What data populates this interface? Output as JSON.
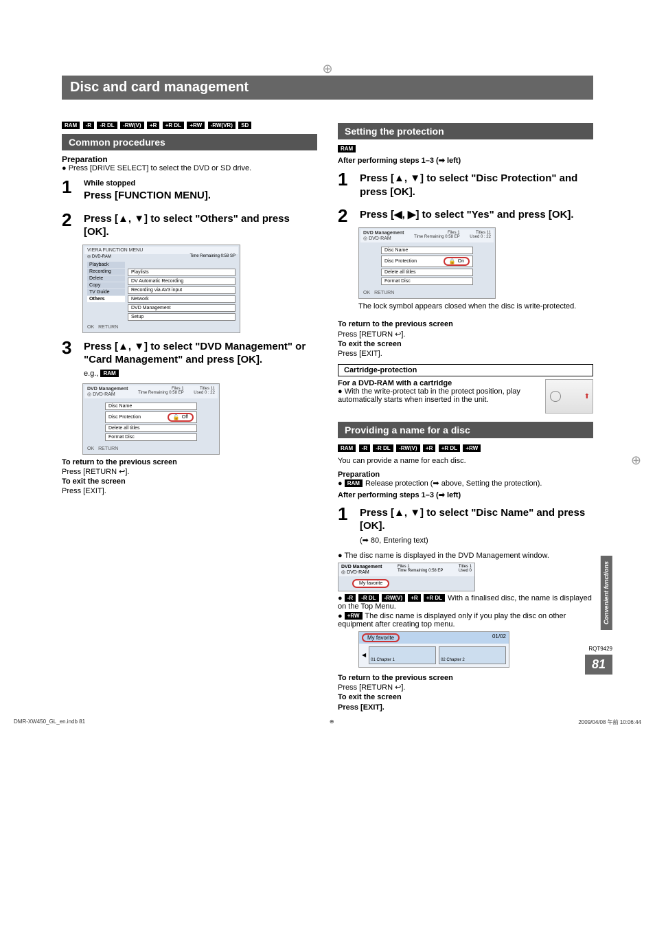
{
  "title": "Disc and card management",
  "badges_top": [
    "RAM",
    "-R",
    "-R DL",
    "-RW(V)",
    "+R",
    "+R DL",
    "+RW",
    "-RW(VR)",
    "SD"
  ],
  "left": {
    "section": "Common procedures",
    "preparation_label": "Preparation",
    "preparation_bullet": "Press [DRIVE SELECT] to select the DVD or SD drive.",
    "step1_sub": "While stopped",
    "step1_main": "Press [FUNCTION MENU].",
    "step2_main": "Press [▲, ▼] to select \"Others\" and press [OK].",
    "step3_main": "Press [▲, ▼] to select \"DVD Management\" or \"Card Management\" and press [OK].",
    "eg_prefix": "e.g.,",
    "eg_badge": "RAM",
    "return_label": "To return to the previous screen",
    "return_text": "Press [RETURN ↩].",
    "exit_label": "To exit the screen",
    "exit_text": "Press [EXIT]."
  },
  "fn_menu": {
    "brand": "VIERA FUNCTION MENU",
    "disc": "DVD-RAM",
    "remain": "Time Remaining   0:58 SP",
    "sidebar": [
      "Playback",
      "Recording",
      "Delete",
      "Copy",
      "TV Guide",
      "Others"
    ],
    "items": [
      "Playlists",
      "DV Automatic Recording",
      "Recording via AV3 input",
      "Network",
      "DVD Management",
      "Setup"
    ],
    "footer_ok": "OK",
    "footer_return": "RETURN"
  },
  "dvd_mgmt": {
    "title": "DVD Management",
    "disc": "DVD-RAM",
    "files": "Files",
    "files_val": "1",
    "remain": "Time Remaining  0:58 EP",
    "titles_label": "Titles",
    "titles_val": "11",
    "used_label": "Used",
    "used_val": "0 : 22",
    "items": [
      "Disc Name",
      "Disc Protection",
      "Delete all titles",
      "Format Disc"
    ],
    "off": "Off",
    "on": "On",
    "footer_ok": "OK",
    "footer_return": "RETURN"
  },
  "right": {
    "section1": "Setting the protection",
    "badge_ram": "RAM",
    "after_steps": "After performing steps 1–3 (➡ left)",
    "s1": "Press [▲, ▼] to select \"Disc Protection\" and press [OK].",
    "s2": "Press [◀, ▶] to select \"Yes\" and press [OK].",
    "lock_note": "The lock symbol appears closed when the disc is write-protected.",
    "return_label": "To return to the previous screen",
    "return_text": "Press [RETURN ↩].",
    "exit_label": "To exit the screen",
    "exit_text": "Press [EXIT].",
    "cartridge_heading": "Cartridge-protection",
    "cartridge_for": "For a DVD-RAM with a cartridge",
    "cartridge_bullet": "With the write-protect tab in the protect position, play automatically starts when inserted in the unit.",
    "section2": "Providing a name for a disc",
    "badges2": [
      "RAM",
      "-R",
      "-R DL",
      "-RW(V)",
      "+R",
      "+R DL",
      "+RW"
    ],
    "provide_line": "You can provide a name for each disc.",
    "prep_label": "Preparation",
    "prep_bullet_prefix": "●",
    "prep_badge": "RAM",
    "prep_bullet_text": " Release protection (➡ above, Setting the protection).",
    "p1": "Press [▲, ▼] to select \"Disc Name\" and press [OK].",
    "p1_note": "(➡ 80, Entering text)",
    "disc_name_window": "The disc name is displayed in the DVD Management window.",
    "myfav": "My favorite",
    "fin_badges": [
      "-R",
      "-R DL",
      "-RW(V)",
      "+R",
      "+R DL"
    ],
    "fin_text": " With a finalised disc, the name is displayed on the Top Menu.",
    "rw_badge": "+RW",
    "rw_text": " The disc name is displayed only if you play the disc on other equipment after creating top menu.",
    "tm_pg": "01/02",
    "tm_ch1": "01\nChapter 1",
    "tm_ch2": "02\nChapter 2",
    "exit_bold": "Press [EXIT]."
  },
  "side_tab": "Convenient functions",
  "rqt": "RQT9429",
  "page_num": "81",
  "footer_left": "DMR-XW450_GL_en.indb   81",
  "footer_right": "2009/04/08   午前 10:06:44"
}
